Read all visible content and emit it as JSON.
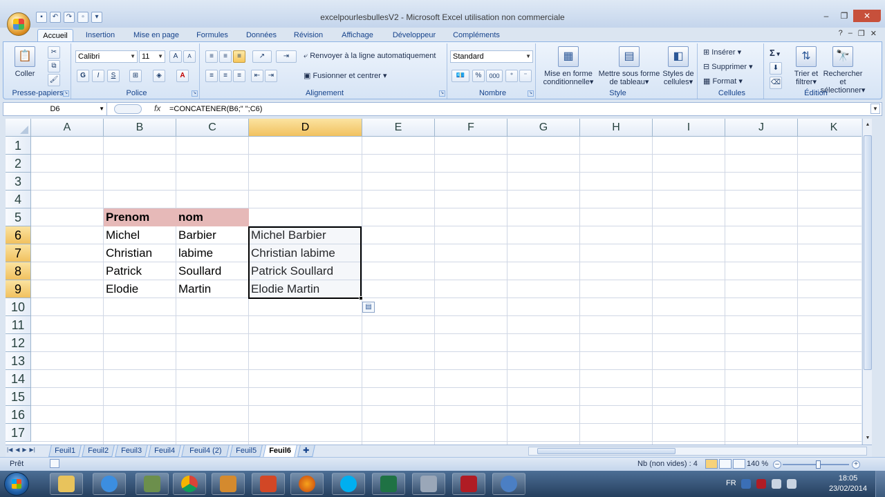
{
  "window": {
    "title": "excelpourlesbullesV2 - Microsoft Excel utilisation non commerciale"
  },
  "ribbon": {
    "tabs": [
      {
        "label": "Accueil",
        "active": true
      },
      {
        "label": "Insertion",
        "active": false
      },
      {
        "label": "Mise en page",
        "active": false
      },
      {
        "label": "Formules",
        "active": false
      },
      {
        "label": "Données",
        "active": false
      },
      {
        "label": "Révision",
        "active": false
      },
      {
        "label": "Affichage",
        "active": false
      },
      {
        "label": "Développeur",
        "active": false
      },
      {
        "label": "Compléments",
        "active": false
      }
    ],
    "groups": {
      "clipboard": {
        "label": "Presse-papiers",
        "paste": "Coller"
      },
      "font": {
        "label": "Police",
        "font_name": "Calibri",
        "font_size": "11",
        "bold": "G",
        "italic": "I",
        "underline": "S"
      },
      "alignment": {
        "label": "Alignement",
        "wrap": "Renvoyer à la ligne automatiquement",
        "merge": "Fusionner et centrer"
      },
      "number": {
        "label": "Nombre",
        "format": "Standard",
        "percent": "%",
        "thousands": "000"
      },
      "style": {
        "label": "Style",
        "cond_format_1": "Mise en forme",
        "cond_format_2": "conditionnelle",
        "table_1": "Mettre sous forme",
        "table_2": "de tableau",
        "cell_styles_1": "Styles de",
        "cell_styles_2": "cellules"
      },
      "cells": {
        "label": "Cellules",
        "insert": "Insérer",
        "delete": "Supprimer",
        "format": "Format"
      },
      "editing": {
        "label": "Édition",
        "sort_1": "Trier et",
        "sort_2": "filtrer",
        "find_1": "Rechercher et",
        "find_2": "sélectionner",
        "sum": "Σ"
      }
    }
  },
  "formula_bar": {
    "name_box": "D6",
    "formula": "=CONCATENER(B6;\" \";C6)",
    "fx": "fx"
  },
  "sheet": {
    "columns": [
      "A",
      "B",
      "C",
      "D",
      "E",
      "F",
      "G",
      "H",
      "I",
      "J",
      "K"
    ],
    "active_column": "D",
    "rows": [
      "1",
      "2",
      "3",
      "4",
      "5",
      "6",
      "7",
      "8",
      "9",
      "10",
      "11",
      "12",
      "13",
      "14",
      "15",
      "16",
      "17"
    ],
    "active_rows": [
      "6",
      "7",
      "8",
      "9"
    ],
    "header_row": {
      "b": "Prenom",
      "c": "nom"
    },
    "data": [
      {
        "b": "Michel",
        "c": "Barbier",
        "d": "Michel Barbier"
      },
      {
        "b": "Christian",
        "c": "labime",
        "d": "Christian labime"
      },
      {
        "b": "Patrick",
        "c": "Soullard",
        "d": "Patrick Soullard"
      },
      {
        "b": "Elodie",
        "c": "Martin",
        "d": "Elodie Martin"
      }
    ],
    "header_fill_color": "#e6b9b8"
  },
  "sheet_tabs": [
    {
      "label": "Feuil1",
      "active": false
    },
    {
      "label": "Feuil2",
      "active": false
    },
    {
      "label": "Feuil3",
      "active": false
    },
    {
      "label": "Feuil4",
      "active": false
    },
    {
      "label": "Feuil4 (2)",
      "active": false
    },
    {
      "label": "Feuil5",
      "active": false
    },
    {
      "label": "Feuil6",
      "active": true
    }
  ],
  "status_bar": {
    "ready": "Prêt",
    "count": "Nb (non vides) : 4",
    "zoom": "140 %"
  },
  "taskbar": {
    "lang": "FR",
    "time": "18:05",
    "date": "23/02/2014"
  }
}
